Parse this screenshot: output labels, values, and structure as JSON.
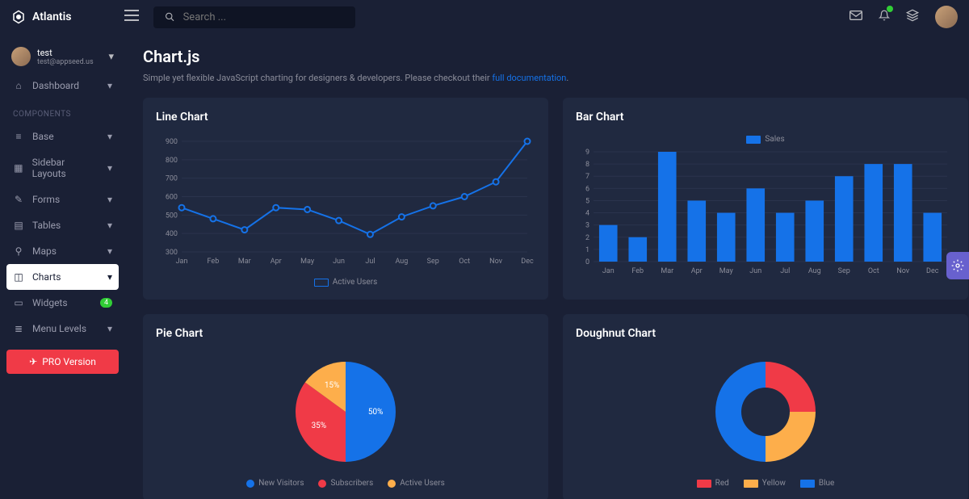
{
  "brand": "Atlantis",
  "search": {
    "placeholder": "Search ..."
  },
  "user": {
    "name": "test",
    "email": "test@appseed.us"
  },
  "nav": {
    "dashboard": "Dashboard",
    "section1": "COMPONENTS",
    "base": "Base",
    "sidebar_layouts": "Sidebar Layouts",
    "forms": "Forms",
    "tables": "Tables",
    "maps": "Maps",
    "charts": "Charts",
    "widgets": "Widgets",
    "widgets_badge": "4",
    "menu_levels": "Menu Levels",
    "pro": "PRO Version"
  },
  "page": {
    "title": "Chart.js",
    "desc_pre": "Simple yet flexible JavaScript charting for designers & developers. Please checkout their ",
    "desc_link": "full documentation",
    "desc_post": "."
  },
  "card_titles": {
    "line": "Line Chart",
    "bar": "Bar Chart",
    "pie": "Pie Chart",
    "doughnut": "Doughnut Chart"
  },
  "chart_data": [
    {
      "type": "line",
      "title": "Line Chart",
      "categories": [
        "Jan",
        "Feb",
        "Mar",
        "Apr",
        "May",
        "Jun",
        "Jul",
        "Aug",
        "Sep",
        "Oct",
        "Nov",
        "Dec"
      ],
      "series": [
        {
          "name": "Active Users",
          "values": [
            540,
            480,
            420,
            540,
            530,
            470,
            395,
            490,
            550,
            600,
            680,
            900
          ]
        }
      ],
      "ylim": [
        300,
        900
      ],
      "ystep": 100,
      "legend": [
        "Active Users"
      ],
      "colors": [
        "#1572e8"
      ]
    },
    {
      "type": "bar",
      "title": "Bar Chart",
      "categories": [
        "Jan",
        "Feb",
        "Mar",
        "Apr",
        "May",
        "Jun",
        "Jul",
        "Aug",
        "Sep",
        "Oct",
        "Nov",
        "Dec"
      ],
      "series": [
        {
          "name": "Sales",
          "values": [
            3,
            2,
            9,
            5,
            4,
            6,
            4,
            5,
            7,
            8,
            8,
            4
          ]
        }
      ],
      "ylim": [
        0,
        9
      ],
      "ystep": 1,
      "legend": [
        "Sales"
      ],
      "colors": [
        "#1572e8"
      ]
    },
    {
      "type": "pie",
      "title": "Pie Chart",
      "series": [
        {
          "name": "New Visitors",
          "value": 50,
          "color": "#1572e8"
        },
        {
          "name": "Subscribers",
          "value": 35,
          "color": "#f03a47"
        },
        {
          "name": "Active Users",
          "value": 15,
          "color": "#fdae4b"
        }
      ],
      "labels": [
        "50%",
        "35%",
        "15%"
      ]
    },
    {
      "type": "doughnut",
      "title": "Doughnut Chart",
      "series": [
        {
          "name": "Red",
          "value": 25,
          "color": "#f03a47"
        },
        {
          "name": "Yellow",
          "value": 25,
          "color": "#fdae4b"
        },
        {
          "name": "Blue",
          "value": 50,
          "color": "#1572e8"
        }
      ]
    }
  ]
}
